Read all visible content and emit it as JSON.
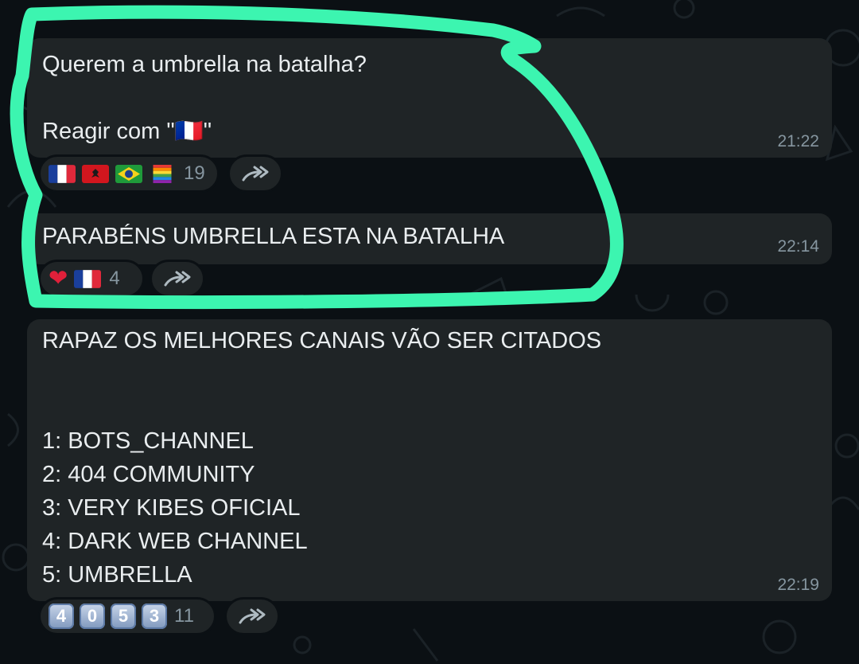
{
  "messages": [
    {
      "text": "Querem a umbrella na batalha?\n\nReagir com \"🇫🇷\"",
      "time": "21:22",
      "reactions": {
        "emojis": [
          "flag-france",
          "flag-albania",
          "flag-brazil",
          "flag-rainbow"
        ],
        "count": "19"
      }
    },
    {
      "text": "PARABÉNS UMBRELLA ESTA NA BATALHA",
      "time": "22:14",
      "reactions": {
        "emojis": [
          "red-heart",
          "flag-france"
        ],
        "count": "4"
      }
    },
    {
      "text": "RAPAZ OS MELHORES CANAIS VÃO SER CITADOS\n\n\n1: BOTS_CHANNEL\n2: 404 COMMUNITY\n3: VERY KIBES OFICIAL\n4: DARK WEB CHANNEL\n5: UMBRELLA",
      "time": "22:19",
      "reactions": {
        "emojis": [
          "keycap-4",
          "keycap-0",
          "keycap-5",
          "keycap-3"
        ],
        "keycaps": [
          "4",
          "0",
          "5",
          "3"
        ],
        "count": "11"
      }
    }
  ],
  "icons": {
    "forward": "forward-arrow-icon"
  },
  "colors": {
    "bubble": "#1f2426",
    "background": "#0b1014",
    "text": "#e9edef",
    "meta": "#8696a0",
    "highlight": "#3cf5b0"
  }
}
